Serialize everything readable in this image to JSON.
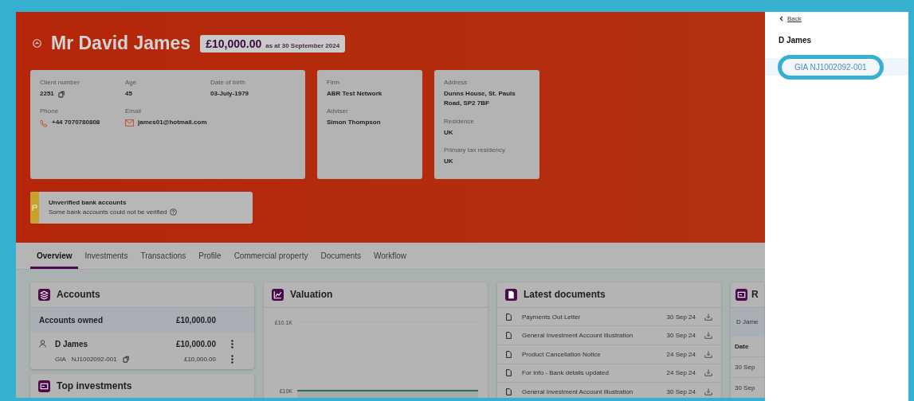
{
  "header": {
    "name": "Mr David James",
    "balance": "£10,000.00",
    "as_at": "as at 30 September 2024",
    "cards": [
      {
        "fields": [
          {
            "label": "Client number",
            "value": "2251",
            "kind": "copy"
          },
          {
            "label": "Age",
            "value": "45",
            "kind": "plain"
          },
          {
            "label": "Date of birth",
            "value": "03-July-1979",
            "kind": "plain"
          },
          {
            "label": "Phone",
            "value": "+44 7070780808",
            "kind": "phone"
          },
          {
            "label": "Email",
            "value": "james01@hotmail.com",
            "kind": "email"
          }
        ]
      },
      {
        "fields": [
          {
            "label": "Firm",
            "value": "ABR Test Network",
            "kind": "plain"
          },
          {
            "label": "Adviser",
            "value": "Simon Thompson",
            "kind": "plain"
          }
        ]
      },
      {
        "fields": [
          {
            "label": "Address",
            "value": "Dunns House, St. Pauls Road, SP2 7BF",
            "kind": "plain"
          },
          {
            "label": "Residence",
            "value": "UK",
            "kind": "plain"
          },
          {
            "label": "Primary tax residency",
            "value": "UK",
            "kind": "plain"
          }
        ]
      }
    ],
    "alert": {
      "title": "Unverified bank accounts",
      "message": "Some bank accounts could not be verified"
    }
  },
  "tabs": [
    {
      "label": "Overview",
      "selected": true
    },
    {
      "label": "Investments",
      "selected": false
    },
    {
      "label": "Transactions",
      "selected": false
    },
    {
      "label": "Profile",
      "selected": false
    },
    {
      "label": "Commercial property",
      "selected": false
    },
    {
      "label": "Documents",
      "selected": false
    },
    {
      "label": "Workflow",
      "selected": false
    }
  ],
  "accounts": {
    "title": "Accounts",
    "summary_label": "Accounts owned",
    "summary_value": "£10,000.00",
    "owner": {
      "name": "D James",
      "value": "£10,000.00"
    },
    "account": {
      "type": "GIA",
      "number": "NJ1002092-001",
      "value": "£10,000.00"
    }
  },
  "top_investments": {
    "title": "Top investments"
  },
  "valuation": {
    "title": "Valuation",
    "chart_data": {
      "type": "area",
      "ylim": [
        10000,
        10100
      ],
      "yticks": [
        {
          "value": 10000,
          "label": "£10K"
        },
        {
          "value": 10100,
          "label": "£10.1K"
        }
      ],
      "series": [
        {
          "color": "#2e6e4e",
          "values": [
            10000,
            10000,
            10000,
            10000,
            10000
          ]
        }
      ]
    }
  },
  "documents": {
    "title": "Latest documents",
    "rows": [
      {
        "name": "Payments Out Letter",
        "date": "30 Sep 24"
      },
      {
        "name": "General Investment Account Illustration",
        "date": "30 Sep 24"
      },
      {
        "name": "Product Cancellation Notice",
        "date": "24 Sep 24"
      },
      {
        "name": "For info - Bank details updated",
        "date": "24 Sep 24"
      },
      {
        "name": "General Investment Account Illustration",
        "date": "30 Sep 24"
      }
    ]
  },
  "fourth_panel": {
    "title": "R",
    "owner": "D Jame",
    "column_1": "Date",
    "rows": [
      "30 Sep",
      "30 Sep"
    ]
  },
  "side_panel": {
    "back": "Back",
    "heading": "D James",
    "items": [
      {
        "label": "GIA NJ1002092-001",
        "selected": true
      }
    ]
  }
}
